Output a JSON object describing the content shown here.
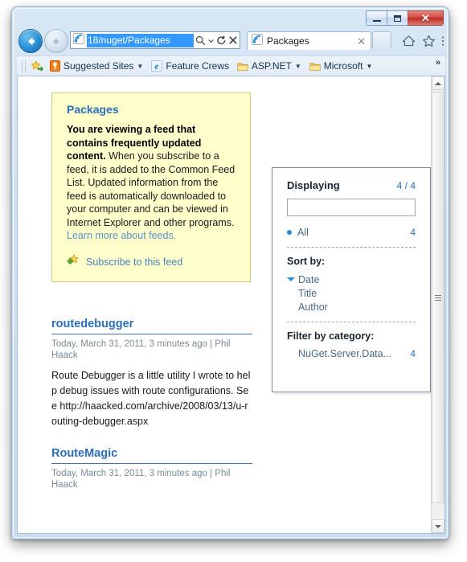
{
  "window": {
    "controls": {
      "minimize": "–",
      "maximize": "□",
      "close": "✕"
    }
  },
  "nav": {
    "back_label": "◀",
    "forward_label": "▶",
    "address_value": "18/nuget/Packages",
    "address_placeholder": "",
    "search_icon": "search-icon",
    "dropdown_icon": "chevron-down-icon",
    "refresh_icon": "refresh-icon",
    "stop_icon": "stop-icon"
  },
  "tabs": [
    {
      "label": "Packages",
      "close": "✕",
      "icon": "feed-icon"
    }
  ],
  "newtab_label": "",
  "toolbar_icons": [
    {
      "name": "home-icon"
    },
    {
      "name": "favorites-star-icon"
    },
    {
      "name": "tools-gear-icon"
    }
  ],
  "favorites_bar": {
    "add_icon": "add-to-favorites-icon",
    "items": [
      {
        "label": "Suggested Sites",
        "icon": "suggested-sites-icon",
        "has_caret": true
      },
      {
        "label": "Feature Crews",
        "icon": "ie-icon",
        "has_caret": false
      },
      {
        "label": "ASP.NET",
        "icon": "folder-icon",
        "has_caret": true
      },
      {
        "label": "Microsoft",
        "icon": "folder-icon",
        "has_caret": true
      }
    ],
    "overflow": "»"
  },
  "feed_notice": {
    "title": "Packages",
    "bold_lead": "You are viewing a feed that contains frequently updated content.",
    "body": " When you subscribe to a feed, it is added to the Common Feed List. Updated information from the feed is automatically downloaded to your computer and can be viewed in Internet Explorer and other programs. ",
    "link_text": "Learn more about feeds.",
    "subscribe_label": "Subscribe to this feed",
    "subscribe_icon": "subscribe-feed-icon",
    "background_color": "#FFFFCC",
    "title_color": "#2A6EBB"
  },
  "filter_panel": {
    "displaying_label": "Displaying",
    "displaying_count": "4 / 4",
    "search_value": "",
    "search_placeholder": "",
    "all_label": "All",
    "all_count": "4",
    "sort_label": "Sort by:",
    "sort_options": [
      {
        "label": "Date",
        "selected": true
      },
      {
        "label": "Title",
        "selected": false
      },
      {
        "label": "Author",
        "selected": false
      }
    ],
    "filter_label": "Filter by category:",
    "categories": [
      {
        "label": "NuGet.Server.Data...",
        "count": "4"
      }
    ],
    "accent_color": "#2A8FD4"
  },
  "entries": [
    {
      "title": "routedebugger",
      "meta": "Today, March 31, 2011, 3 minutes ago | Phil Haack",
      "body": "Route Debugger is a little utility I wrote to help debug issues with route configurations. See http://haacked.com/archive/2008/03/13/u-routing-debugger.aspx"
    },
    {
      "title": "RouteMagic",
      "meta": "Today, March 31, 2011, 3 minutes ago | Phil Haack",
      "body": ""
    }
  ],
  "scrollbar": {
    "up_arrow": "▲",
    "down_arrow": "▼"
  }
}
